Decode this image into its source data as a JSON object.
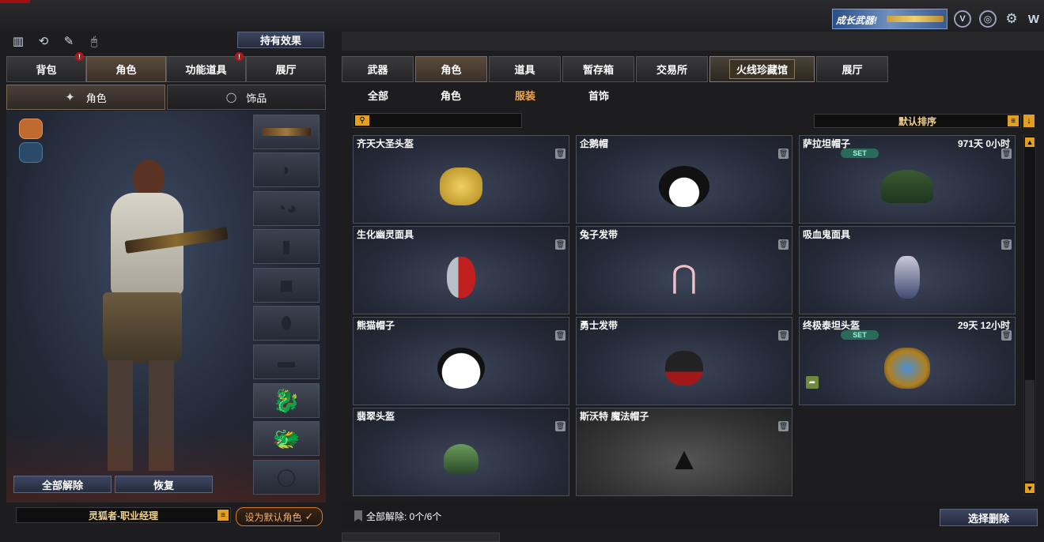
{
  "top": {
    "banner_text": "成长武器!",
    "icons": [
      "badge-v-icon",
      "steering-wheel-icon",
      "settings-gear-icon",
      "brand-w-icon"
    ]
  },
  "left_toolbar": {
    "icons": [
      "stats-icon",
      "refresh-icon",
      "user-edit-icon",
      "mouse-icon"
    ],
    "effects_button": "持有效果"
  },
  "left_tabs": [
    {
      "label": "背包",
      "active": false,
      "alert": true
    },
    {
      "label": "角色",
      "active": true,
      "alert": false
    },
    {
      "label": "功能道具",
      "active": false,
      "alert": true
    },
    {
      "label": "展厅",
      "active": false,
      "alert": false
    }
  ],
  "left_subtabs": [
    {
      "label": "角色",
      "icon": "character-icon",
      "active": true
    },
    {
      "label": "饰品",
      "icon": "ring-icon",
      "active": false
    }
  ],
  "equipment_slots": [
    {
      "name": "weapon-slot",
      "filled": true,
      "icon": "smg-icon"
    },
    {
      "name": "helmet-slot",
      "filled": false,
      "icon": "helmet-icon"
    },
    {
      "name": "goggles-slot",
      "filled": false,
      "icon": "goggles-icon"
    },
    {
      "name": "radio-slot",
      "filled": false,
      "icon": "radio-icon"
    },
    {
      "name": "vest-slot",
      "filled": false,
      "icon": "vest-icon"
    },
    {
      "name": "bag-slot",
      "filled": false,
      "icon": "bag-icon"
    },
    {
      "name": "pouch-slot",
      "filled": false,
      "icon": "pouch-icon"
    },
    {
      "name": "golden-dragon-slot",
      "filled": true,
      "icon": "golden-dragon-icon"
    },
    {
      "name": "ice-dragon-slot",
      "filled": true,
      "icon": "ice-dragon-icon"
    },
    {
      "name": "ring-slot",
      "filled": false,
      "icon": "ring-icon"
    }
  ],
  "left_bottom": {
    "unequip_all": "全部解除",
    "restore": "恢复",
    "character_name": "灵狐者-职业经理",
    "set_default": "设为默认角色"
  },
  "right_tabs": [
    {
      "label": "武器",
      "active": false
    },
    {
      "label": "角色",
      "active": true
    },
    {
      "label": "道具",
      "active": false
    },
    {
      "label": "暂存箱",
      "active": false
    },
    {
      "label": "交易所",
      "active": false
    },
    {
      "label": "火线珍藏馆",
      "active": false,
      "special": true
    },
    {
      "label": "展厅",
      "active": false
    }
  ],
  "right_subtabs": [
    {
      "label": "全部",
      "active": false
    },
    {
      "label": "角色",
      "active": false
    },
    {
      "label": "服装",
      "active": true
    },
    {
      "label": "首饰",
      "active": false
    }
  ],
  "search": {
    "placeholder": "",
    "value": ""
  },
  "sort": {
    "label": "默认排序"
  },
  "items": [
    {
      "name": "齐天大圣头盔",
      "time": "",
      "set": false,
      "icon": "monkey-king-helmet-icon"
    },
    {
      "name": "企鹅帽",
      "time": "",
      "set": false,
      "icon": "penguin-hat-icon"
    },
    {
      "name": "萨拉坦帽子",
      "time": "971天 0小时",
      "set": true,
      "icon": "camo-cap-icon"
    },
    {
      "name": "生化幽灵面具",
      "time": "",
      "set": false,
      "icon": "zombie-mask-icon"
    },
    {
      "name": "兔子发带",
      "time": "",
      "set": false,
      "icon": "bunny-headband-icon"
    },
    {
      "name": "吸血鬼面具",
      "time": "",
      "set": false,
      "icon": "vampire-mask-icon"
    },
    {
      "name": "熊猫帽子",
      "time": "",
      "set": false,
      "icon": "panda-hat-icon"
    },
    {
      "name": "勇士发带",
      "time": "",
      "set": false,
      "icon": "warrior-headband-icon"
    },
    {
      "name": "终极泰坦头盔",
      "time": "29天 12小时",
      "set": true,
      "icon": "titan-helmet-icon",
      "shareable": true
    },
    {
      "name": "翡翠头盔",
      "time": "",
      "set": false,
      "icon": "jade-helmet-icon"
    },
    {
      "name": "斯沃特 魔法帽子",
      "time": "",
      "set": false,
      "icon": "witch-hat-icon"
    }
  ],
  "set_label": "SET",
  "bottom": {
    "unequip_status": "全部解除: 0个/6个",
    "select_delete": "选择删除"
  },
  "colors": {
    "accent": "#f0a850",
    "tab_active": "#5a4a3c",
    "button": "#2e3650"
  }
}
